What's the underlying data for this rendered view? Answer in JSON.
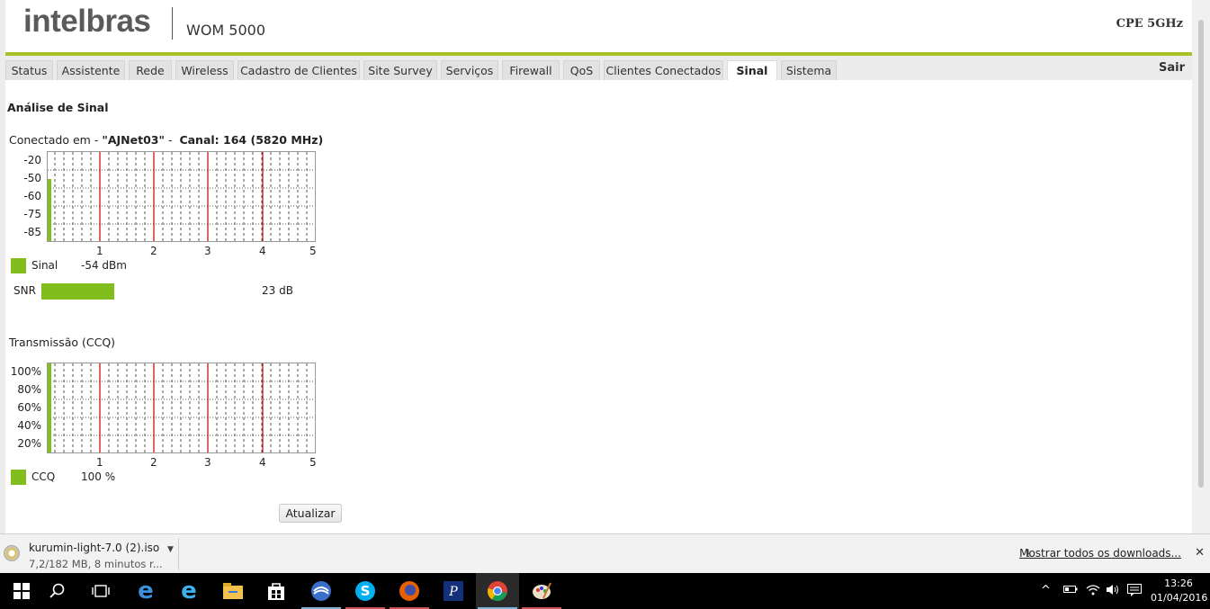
{
  "header": {
    "brand": "intelbras",
    "model": "WOM 5000",
    "device_type": "CPE 5GHz"
  },
  "tabs": [
    {
      "label": "Status"
    },
    {
      "label": "Assistente"
    },
    {
      "label": "Rede"
    },
    {
      "label": "Wireless"
    },
    {
      "label": "Cadastro de Clientes"
    },
    {
      "label": "Site Survey"
    },
    {
      "label": "Serviços"
    },
    {
      "label": "Firewall"
    },
    {
      "label": "QoS"
    },
    {
      "label": "Clientes Conectados"
    },
    {
      "label": "Sinal",
      "active": true
    },
    {
      "label": "Sistema"
    }
  ],
  "logout_label": "Sair",
  "page_title": "Análise de Sinal",
  "connection": {
    "prefix": "Conectado em -",
    "ssid": "\"AJNet03\"",
    "separator": "-",
    "channel": "Canal: 164 (5820 MHz)"
  },
  "signal_chart": {
    "y_ticks": [
      "-20",
      "-50",
      "-60",
      "-75",
      "-85"
    ],
    "x_ticks": [
      "1",
      "2",
      "3",
      "4",
      "5"
    ],
    "legend_label": "Sinal",
    "legend_value": "-54 dBm",
    "current_level": 0.7
  },
  "snr": {
    "label": "SNR",
    "value": "23 dB",
    "level": 0.27
  },
  "ccq_chart": {
    "section_title": "Transmissão (CCQ)",
    "y_ticks": [
      "100%",
      "80%",
      "60%",
      "40%",
      "20%"
    ],
    "x_ticks": [
      "1",
      "2",
      "3",
      "4",
      "5"
    ],
    "legend_label": "CCQ",
    "legend_value": "100 %",
    "current_level": 1.0
  },
  "refresh_button": "Atualizar",
  "colors": {
    "accent_green": "#a6c226",
    "bar_green": "#82bd1e",
    "marker_red": "#cc0000"
  },
  "download_bar": {
    "file_name": "kurumin-light-7.0 (2).iso",
    "status": "7,2/182 MB, 8 minutos r...",
    "show_all": "Mostrar todos os downloads..."
  },
  "taskbar": {
    "icons": [
      "windows-start-icon",
      "search-icon",
      "task-view-icon",
      "edge-icon",
      "ie-icon",
      "file-explorer-icon",
      "store-icon",
      "app-circle-icon",
      "skype-icon",
      "firefox-icon",
      "pdf-app-icon",
      "chrome-icon",
      "paint-icon"
    ],
    "time": "13:26",
    "date": "01/04/2016"
  }
}
